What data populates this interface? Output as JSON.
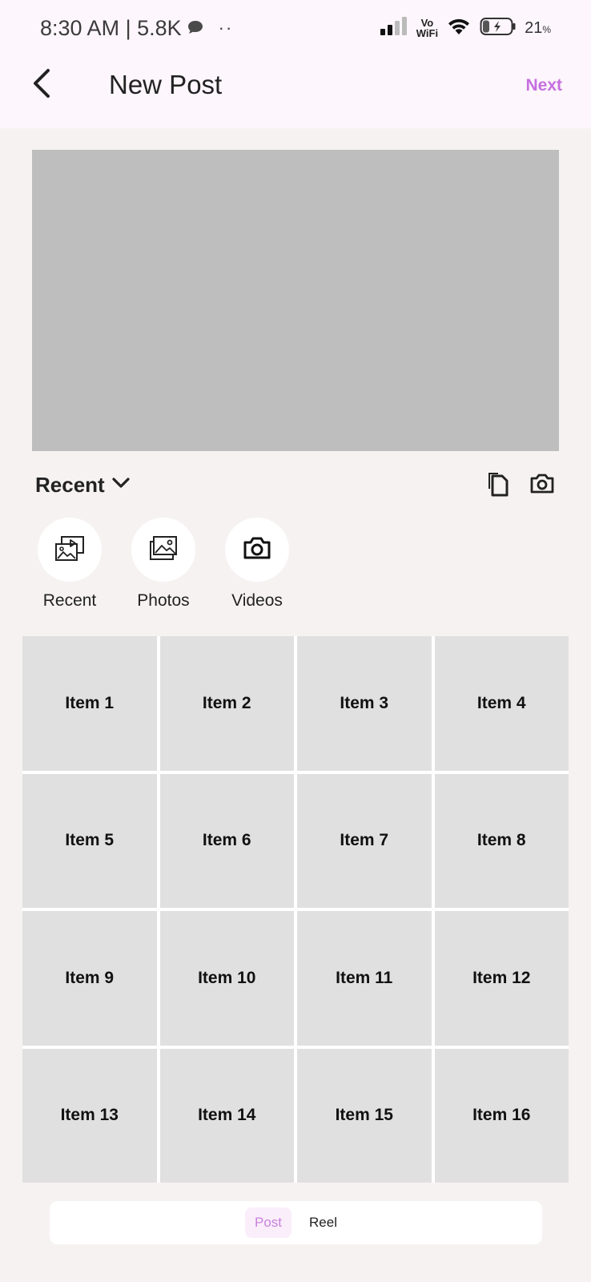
{
  "status_bar": {
    "time": "8:30 AM | 5.8K",
    "dots": "··",
    "network_label_top": "Vo",
    "network_label_bottom": "WiFi",
    "battery_pct": "21",
    "battery_unit": "%"
  },
  "app_bar": {
    "title": "New Post",
    "next_label": "Next"
  },
  "album_selector": {
    "label": "Recent"
  },
  "sources": [
    {
      "label": "Recent",
      "icon": "gallery-video-icon"
    },
    {
      "label": "Photos",
      "icon": "image-icon"
    },
    {
      "label": "Videos",
      "icon": "camera-icon"
    }
  ],
  "grid_items": [
    "Item 1",
    "Item 2",
    "Item 3",
    "Item 4",
    "Item 5",
    "Item 6",
    "Item 7",
    "Item 8",
    "Item 9",
    "Item 10",
    "Item 11",
    "Item 12",
    "Item 13",
    "Item 14",
    "Item 15",
    "Item 16"
  ],
  "modes": {
    "post": "Post",
    "reel": "Reel"
  },
  "colors": {
    "accent": "#c66fe0",
    "top_bg": "#fdf6fc",
    "page_bg": "#f7f2f2",
    "preview_placeholder": "#bdbebd",
    "cell_bg": "#e0e0e0"
  }
}
